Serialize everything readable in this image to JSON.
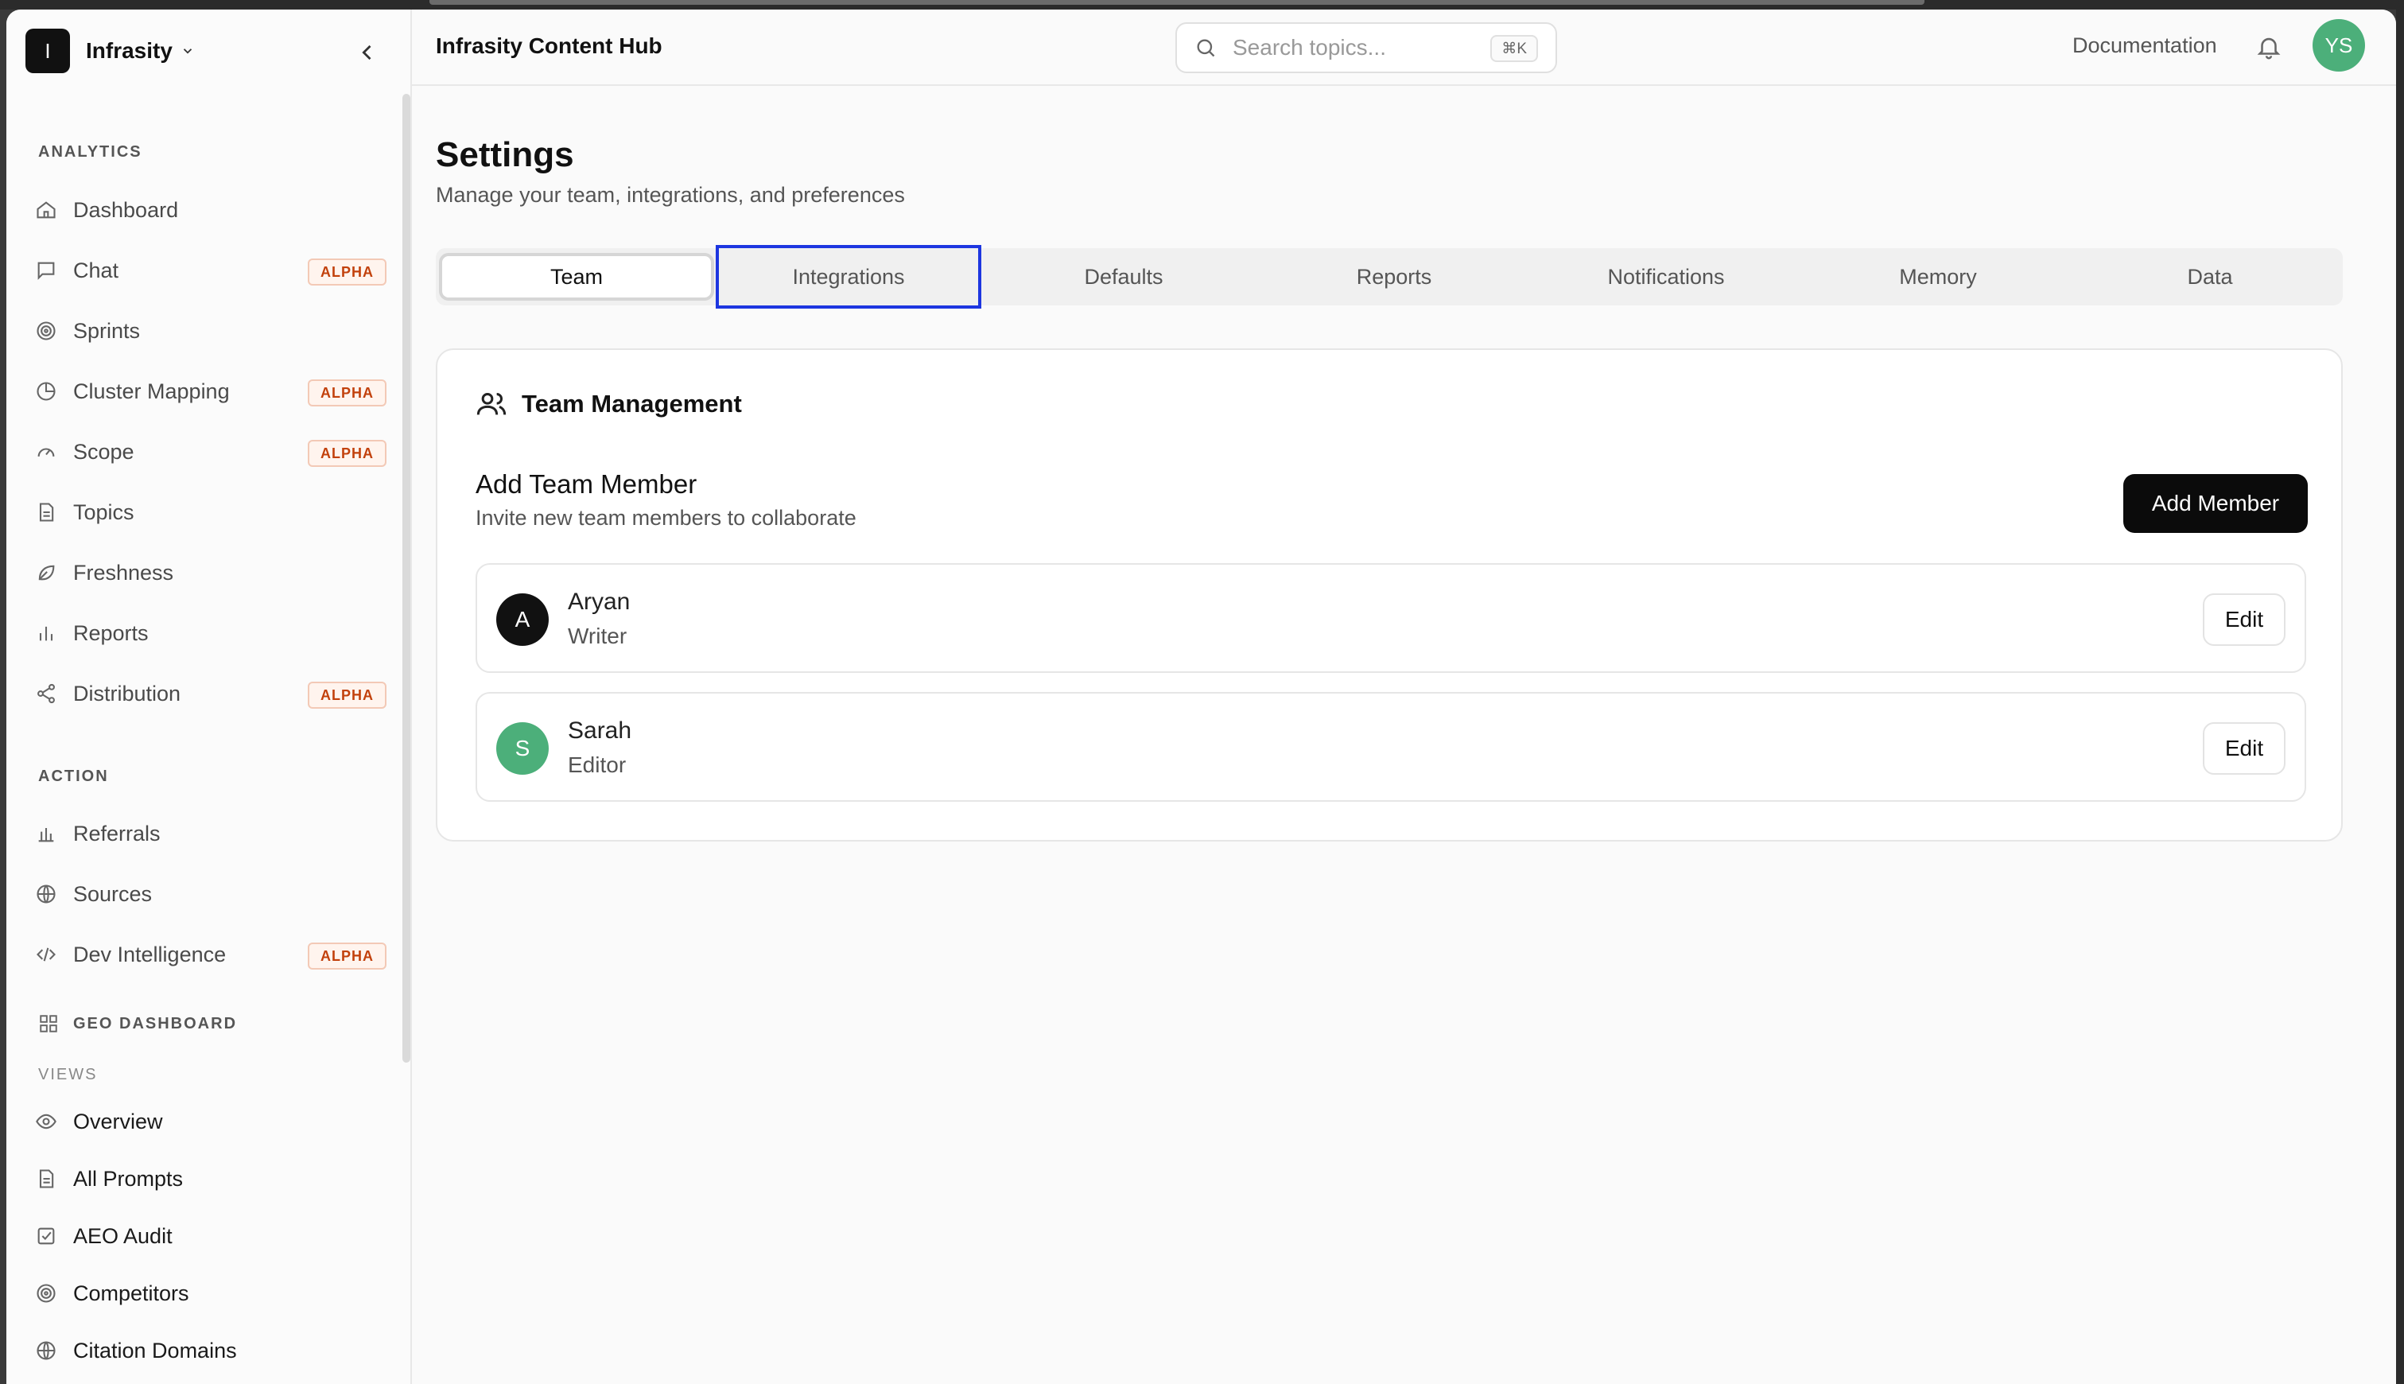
{
  "sidebar": {
    "brand_initial": "I",
    "brand_name": "Infrasity",
    "sections": {
      "analytics": "ANALYTICS",
      "action": "ACTION",
      "geo_dashboard": "GEO DASHBOARD",
      "views": "VIEWS"
    },
    "analytics_items": [
      {
        "label": "Dashboard",
        "icon": "home-icon"
      },
      {
        "label": "Chat",
        "icon": "chat-icon",
        "badge": "ALPHA"
      },
      {
        "label": "Sprints",
        "icon": "target-icon"
      },
      {
        "label": "Cluster Mapping",
        "icon": "pie-chart-icon",
        "badge": "ALPHA"
      },
      {
        "label": "Scope",
        "icon": "gauge-icon",
        "badge": "ALPHA"
      },
      {
        "label": "Topics",
        "icon": "document-icon"
      },
      {
        "label": "Freshness",
        "icon": "leaf-icon"
      },
      {
        "label": "Reports",
        "icon": "bar-chart-icon"
      },
      {
        "label": "Distribution",
        "icon": "share-icon",
        "badge": "ALPHA"
      }
    ],
    "action_items": [
      {
        "label": "Referrals",
        "icon": "bar-chart-icon"
      },
      {
        "label": "Sources",
        "icon": "globe-icon"
      },
      {
        "label": "Dev Intelligence",
        "icon": "code-icon",
        "badge": "ALPHA"
      }
    ],
    "view_items": [
      {
        "label": "Overview",
        "icon": "eye-icon"
      },
      {
        "label": "All Prompts",
        "icon": "document-icon"
      },
      {
        "label": "AEO Audit",
        "icon": "checkbox-icon"
      },
      {
        "label": "Competitors",
        "icon": "target-icon"
      },
      {
        "label": "Citation Domains",
        "icon": "globe-icon"
      }
    ]
  },
  "header": {
    "app_title": "Infrasity Content Hub",
    "search_placeholder": "Search topics...",
    "search_shortcut": "⌘K",
    "documentation": "Documentation",
    "user_initials": "YS"
  },
  "page": {
    "title": "Settings",
    "subtitle": "Manage your team, integrations, and preferences",
    "tabs": [
      "Team",
      "Integrations",
      "Defaults",
      "Reports",
      "Notifications",
      "Memory",
      "Data"
    ],
    "active_tab": "Team"
  },
  "team": {
    "heading": "Team Management",
    "add_title": "Add Team Member",
    "add_subtitle": "Invite new team members to collaborate",
    "add_button": "Add Member",
    "members": [
      {
        "initial": "A",
        "name": "Aryan",
        "role": "Writer",
        "color": "#111111"
      },
      {
        "initial": "S",
        "name": "Sarah",
        "role": "Editor",
        "color": "#4caf7a"
      }
    ],
    "edit_label": "Edit"
  }
}
